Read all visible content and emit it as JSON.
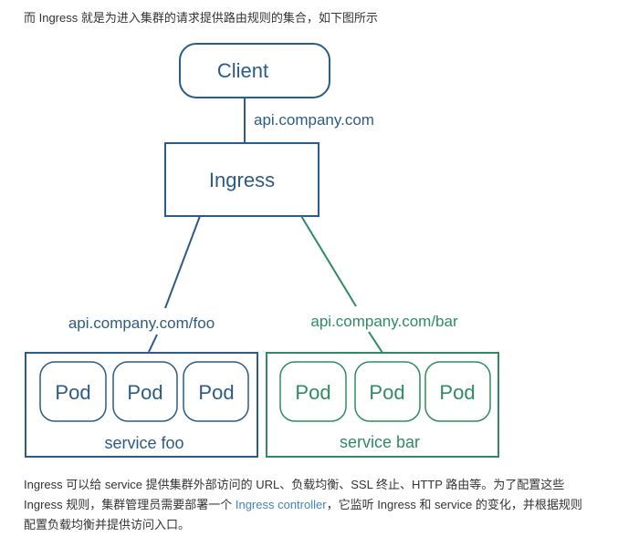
{
  "intro_text": "而 Ingress 就是为进入集群的请求提供路由规则的集合，如下图所示",
  "diagram": {
    "colors": {
      "blue": "#2b5b86",
      "green": "#2e8b62"
    },
    "client": {
      "label": "Client"
    },
    "client_edge_label": "api.company.com",
    "ingress": {
      "label": "Ingress"
    },
    "services": [
      {
        "name": "service foo",
        "route": "api.company.com/foo",
        "color": "blue",
        "pods": [
          "Pod",
          "Pod",
          "Pod"
        ]
      },
      {
        "name": "service bar",
        "route": "api.company.com/bar",
        "color": "green",
        "pods": [
          "Pod",
          "Pod",
          "Pod"
        ]
      }
    ]
  },
  "paragraph": {
    "line1": "Ingress 可以给 service 提供集群外部访问的 URL、负载均衡、SSL 终止、HTTP 路由等。为了配置这些",
    "line2_before": "Ingress 规则，集群管理员需要部署一个 ",
    "line2_link": "Ingress controller",
    "line2_after": "，它监听 Ingress 和 service 的变化，并根据规则",
    "line3": "配置负载均衡并提供访问入口。"
  }
}
